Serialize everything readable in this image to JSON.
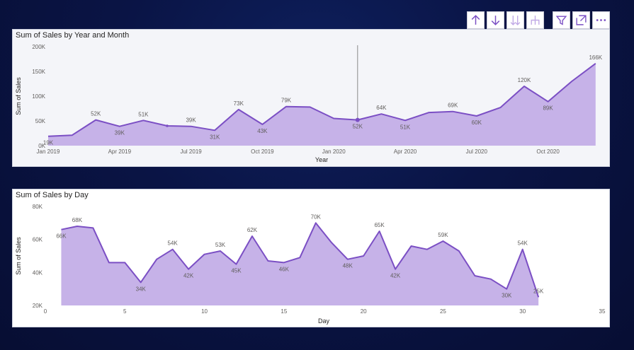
{
  "colors": {
    "line": "#7b4fc4",
    "area": "#c6b2e8",
    "axis_text": "#605e5c",
    "title_text": "#252423",
    "toolbar_icon": "#7b4fc4"
  },
  "toolbar": {
    "icons": [
      "drill-up-icon",
      "drill-down-icon",
      "expand-all-down-icon",
      "expand-hierarchy-icon",
      "filter-icon",
      "focus-mode-icon",
      "more-options-icon"
    ]
  },
  "chart_data": [
    {
      "type": "area",
      "title": "Sum of Sales by Year and Month",
      "xlabel": "Year",
      "ylabel": "Sum of Sales",
      "ylim": [
        0,
        200000
      ],
      "y_ticks": [
        "0K",
        "50K",
        "100K",
        "150K",
        "200K"
      ],
      "x_ticks": [
        "Jan 2019",
        "Apr 2019",
        "Jul 2019",
        "Oct 2019",
        "Jan 2020",
        "Apr 2020",
        "Jul 2020",
        "Oct 2020"
      ],
      "x": [
        "2019-01",
        "2019-02",
        "2019-03",
        "2019-04",
        "2019-05",
        "2019-06",
        "2019-07",
        "2019-08",
        "2019-09",
        "2019-10",
        "2019-11",
        "2019-12",
        "2020-01",
        "2020-02",
        "2020-03",
        "2020-04",
        "2020-05",
        "2020-06",
        "2020-07",
        "2020-08",
        "2020-09",
        "2020-10",
        "2020-11",
        "2020-12"
      ],
      "values": [
        19000,
        21000,
        52000,
        39000,
        51000,
        40000,
        39000,
        31000,
        73000,
        43000,
        79000,
        78000,
        55000,
        52000,
        64000,
        51000,
        67000,
        69000,
        60000,
        77000,
        120000,
        89000,
        130000,
        166000
      ],
      "data_labels": [
        {
          "i": 0,
          "text": "19K",
          "pos": "below"
        },
        {
          "i": 2,
          "text": "52K",
          "pos": "above"
        },
        {
          "i": 3,
          "text": "39K",
          "pos": "below"
        },
        {
          "i": 4,
          "text": "51K",
          "pos": "above"
        },
        {
          "i": 6,
          "text": "39K",
          "pos": "above"
        },
        {
          "i": 7,
          "text": "31K",
          "pos": "below"
        },
        {
          "i": 8,
          "text": "73K",
          "pos": "above"
        },
        {
          "i": 9,
          "text": "43K",
          "pos": "below"
        },
        {
          "i": 10,
          "text": "79K",
          "pos": "above"
        },
        {
          "i": 13,
          "text": "52K",
          "pos": "below"
        },
        {
          "i": 14,
          "text": "64K",
          "pos": "above"
        },
        {
          "i": 15,
          "text": "51K",
          "pos": "below"
        },
        {
          "i": 17,
          "text": "69K",
          "pos": "above"
        },
        {
          "i": 18,
          "text": "60K",
          "pos": "below"
        },
        {
          "i": 20,
          "text": "120K",
          "pos": "above"
        },
        {
          "i": 21,
          "text": "89K",
          "pos": "below"
        },
        {
          "i": 23,
          "text": "166K",
          "pos": "above"
        }
      ],
      "highlight_index": 13
    },
    {
      "type": "area",
      "title": "Sum of Sales by Day",
      "xlabel": "Day",
      "ylabel": "Sum of Sales",
      "ylim": [
        20000,
        80000
      ],
      "xlim": [
        0,
        35
      ],
      "y_ticks": [
        "20K",
        "40K",
        "60K",
        "80K"
      ],
      "x_ticks": [
        "0",
        "5",
        "10",
        "15",
        "20",
        "25",
        "30",
        "35"
      ],
      "x": [
        1,
        2,
        3,
        4,
        5,
        6,
        7,
        8,
        9,
        10,
        11,
        12,
        13,
        14,
        15,
        16,
        17,
        18,
        19,
        20,
        21,
        22,
        23,
        24,
        25,
        26,
        27,
        28,
        29,
        30,
        31
      ],
      "values": [
        66000,
        68000,
        67000,
        46000,
        46000,
        34000,
        48000,
        54000,
        42000,
        51000,
        53000,
        45000,
        62000,
        47000,
        46000,
        49000,
        70000,
        58000,
        48000,
        50000,
        65000,
        42000,
        56000,
        54000,
        59000,
        53000,
        38000,
        36000,
        30000,
        54000,
        25000
      ],
      "data_labels": [
        {
          "i": 0,
          "text": "66K",
          "pos": "below-left"
        },
        {
          "i": 1,
          "text": "68K",
          "pos": "above"
        },
        {
          "i": 5,
          "text": "34K",
          "pos": "below"
        },
        {
          "i": 7,
          "text": "54K",
          "pos": "above"
        },
        {
          "i": 8,
          "text": "42K",
          "pos": "below"
        },
        {
          "i": 10,
          "text": "53K",
          "pos": "above"
        },
        {
          "i": 11,
          "text": "45K",
          "pos": "below"
        },
        {
          "i": 12,
          "text": "62K",
          "pos": "above"
        },
        {
          "i": 14,
          "text": "46K",
          "pos": "below"
        },
        {
          "i": 16,
          "text": "70K",
          "pos": "above"
        },
        {
          "i": 18,
          "text": "48K",
          "pos": "below"
        },
        {
          "i": 20,
          "text": "65K",
          "pos": "above"
        },
        {
          "i": 21,
          "text": "42K",
          "pos": "below"
        },
        {
          "i": 24,
          "text": "59K",
          "pos": "above"
        },
        {
          "i": 28,
          "text": "30K",
          "pos": "below"
        },
        {
          "i": 29,
          "text": "54K",
          "pos": "above"
        },
        {
          "i": 30,
          "text": "25K",
          "pos": "above"
        }
      ]
    }
  ]
}
